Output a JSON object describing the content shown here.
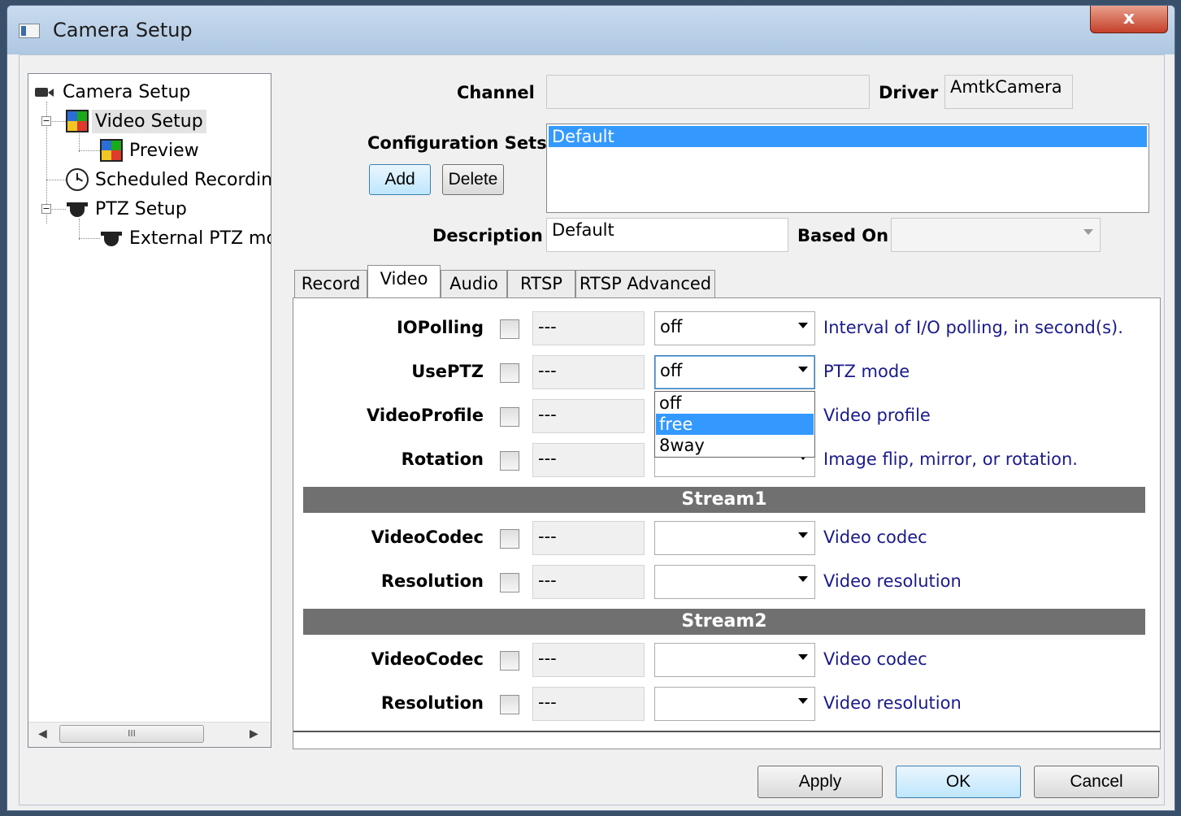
{
  "window": {
    "title": "Camera Setup",
    "close_glyph": "x"
  },
  "tree": {
    "items": [
      {
        "label": "Camera Setup",
        "icon": "camera-icon"
      },
      {
        "label": "Video Setup",
        "icon": "video-grid-icon",
        "selected": true
      },
      {
        "label": "Preview",
        "icon": "video-grid-icon"
      },
      {
        "label": "Scheduled Recording",
        "icon": "clock-icon"
      },
      {
        "label": "PTZ Setup",
        "icon": "dome-camera-icon"
      },
      {
        "label": "External PTZ mod",
        "icon": "dome-camera-icon"
      }
    ],
    "scroll_thumb": "III"
  },
  "header": {
    "channel_label": "Channel",
    "channel_value": "",
    "driver_label": "Driver",
    "driver_value": "AmtkCamera",
    "config_sets_label": "Configuration Sets",
    "config_sets": [
      "Default"
    ],
    "add_label": "Add",
    "delete_label": "Delete",
    "description_label": "Description",
    "description_value": "Default",
    "based_on_label": "Based On",
    "based_on_value": ""
  },
  "tabs": [
    {
      "label": "Record"
    },
    {
      "label": "Video",
      "active": true
    },
    {
      "label": "Audio"
    },
    {
      "label": "RTSP"
    },
    {
      "label": "RTSP Advanced"
    }
  ],
  "params": {
    "general": [
      {
        "name": "IOPolling",
        "value": "---",
        "option": "off",
        "desc": "Interval of I/O polling, in second(s)."
      },
      {
        "name": "UsePTZ",
        "value": "---",
        "option": "off",
        "desc": "PTZ mode"
      },
      {
        "name": "VideoProfile",
        "value": "---",
        "option": "",
        "desc": "Video profile"
      },
      {
        "name": "Rotation",
        "value": "---",
        "option": "",
        "desc": "Image flip, mirror, or rotation."
      }
    ],
    "stream1_title": "Stream1",
    "stream1": [
      {
        "name": "VideoCodec",
        "value": "---",
        "option": "",
        "desc": "Video codec"
      },
      {
        "name": "Resolution",
        "value": "---",
        "option": "",
        "desc": "Video resolution"
      }
    ],
    "stream2_title": "Stream2",
    "stream2": [
      {
        "name": "VideoCodec",
        "value": "---",
        "option": "",
        "desc": "Video codec"
      },
      {
        "name": "Resolution",
        "value": "---",
        "option": "",
        "desc": "Video resolution"
      }
    ]
  },
  "ptz_dropdown": {
    "options": [
      "off",
      "free",
      "8way"
    ],
    "highlighted": "free"
  },
  "footer": {
    "apply_label": "Apply",
    "ok_label": "OK",
    "cancel_label": "Cancel"
  }
}
